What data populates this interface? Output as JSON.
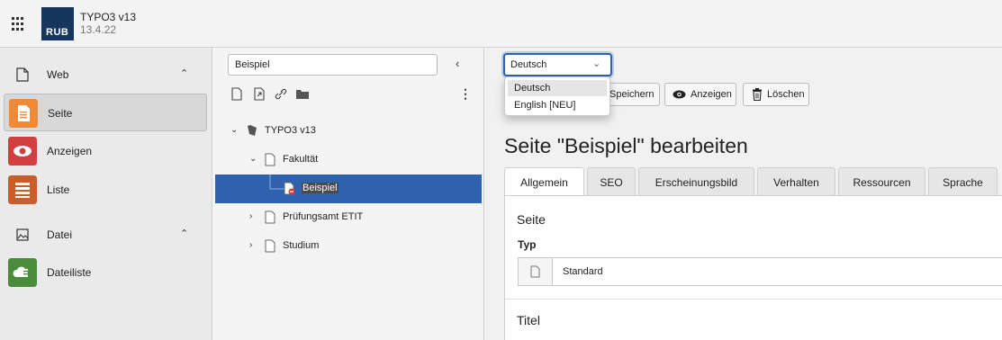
{
  "topbar": {
    "logo_text": "RUB",
    "site_name": "TYPO3 v13",
    "site_version": "13.4.22"
  },
  "modules": {
    "groups": [
      {
        "label": "Web",
        "icon": "page-outline-icon"
      },
      {
        "label": "Datei",
        "icon": "image-icon"
      }
    ],
    "items": [
      {
        "label": "Seite",
        "icon": "page-module-icon",
        "color": "#f18a36"
      },
      {
        "label": "Anzeigen",
        "icon": "eye-icon",
        "color": "#d0403f"
      },
      {
        "label": "Liste",
        "icon": "list-icon",
        "color": "#c95e2b"
      },
      {
        "label": "Dateiliste",
        "icon": "cloud-files-icon",
        "color": "#4b8c3c"
      }
    ]
  },
  "tree": {
    "search_value": "Beispiel",
    "nodes": [
      {
        "label": "TYPO3 v13"
      },
      {
        "label": "Fakultät"
      },
      {
        "label": "Beispiel"
      },
      {
        "label": "Prüfungsamt ETIT"
      },
      {
        "label": "Studium"
      }
    ]
  },
  "toolbar": {
    "language_value": "Deutsch",
    "language_options": [
      "Deutsch",
      "English [NEU]"
    ],
    "save_label": "Speichern",
    "view_label": "Anzeigen",
    "delete_label": "Löschen"
  },
  "editor": {
    "heading": "Seite \"Beispiel\" bearbeiten",
    "tabs": [
      "Allgemein",
      "SEO",
      "Erscheinungsbild",
      "Verhalten",
      "Ressourcen",
      "Sprache"
    ],
    "section_seite": "Seite",
    "field_typ_label": "Typ",
    "field_typ_value": "Standard",
    "section_titel": "Titel"
  },
  "colors": {
    "selection": "#2f62ae",
    "logo_bg": "#17365d"
  }
}
